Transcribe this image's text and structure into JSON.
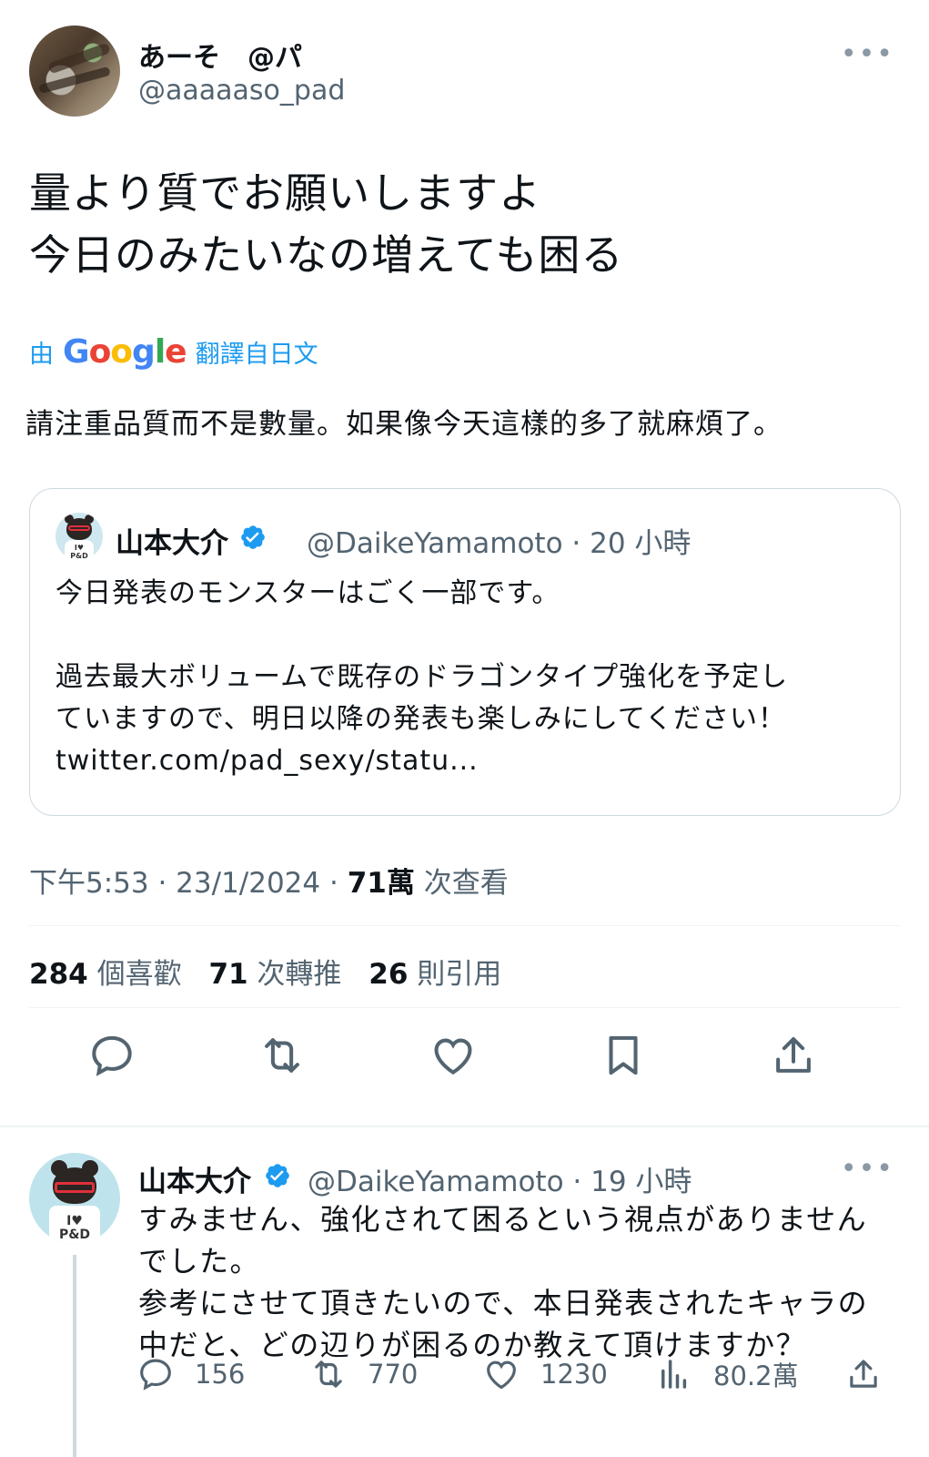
{
  "main_tweet": {
    "display_name": "あーそ　@パ",
    "handle": "@aaaaaso_pad",
    "more_label": "•••",
    "text": "量より質でお願いしますよ\n今日のみたいなの増えても困る",
    "translate_prefix": "由",
    "translate_brand": "Google",
    "translate_suffix": "翻譯自日文",
    "translation": "請注重品質而不是數量。如果像今天這樣的多了就麻煩了。",
    "quote": {
      "name": "山本大介",
      "handle_time": "@DaikeYamamoto · 20 小時",
      "text": "今日発表のモンスターはごく一部です。\n\n過去最大ボリュームで既存のドラゴンタイプ強化を予定し\nていますので、明日以降の発表も楽しみにしてください！\ntwitter.com/pad_sexy/statu...",
      "avatar_shirt": "I♥\nP&D"
    },
    "timestamp": "下午5:53 · 23/1/2024 · ",
    "views_count": "71萬",
    "views_label": " 次查看",
    "stats": {
      "likes_count": "284",
      "likes_label": " 個喜歡",
      "retweets_count": "71",
      "retweets_label": " 次轉推",
      "quotes_count": "26",
      "quotes_label": " 則引用"
    }
  },
  "reply": {
    "name": "山本大介",
    "handle_time": "@DaikeYamamoto · 19 小時",
    "more_label": "•••",
    "text": "すみません、強化されて困るという視点がありません\nでした。\n参考にさせて頂きたいので、本日発表されたキャラの\n中だと、どの辺りが困るのか教えて頂けますか？",
    "avatar_shirt": "I♥\nP&D",
    "replies": "156",
    "retweets": "770",
    "likes": "1230",
    "views": "80.2萬"
  },
  "colors": {
    "accent": "#1d9bf0",
    "text_primary": "#0f1419",
    "text_secondary": "#536471",
    "border": "#cfd9de",
    "verified": "#1d9bf0"
  },
  "icons": [
    "reply-icon",
    "retweet-icon",
    "like-icon",
    "bookmark-icon",
    "share-icon",
    "views-icon",
    "verified-badge-icon",
    "more-icon"
  ]
}
